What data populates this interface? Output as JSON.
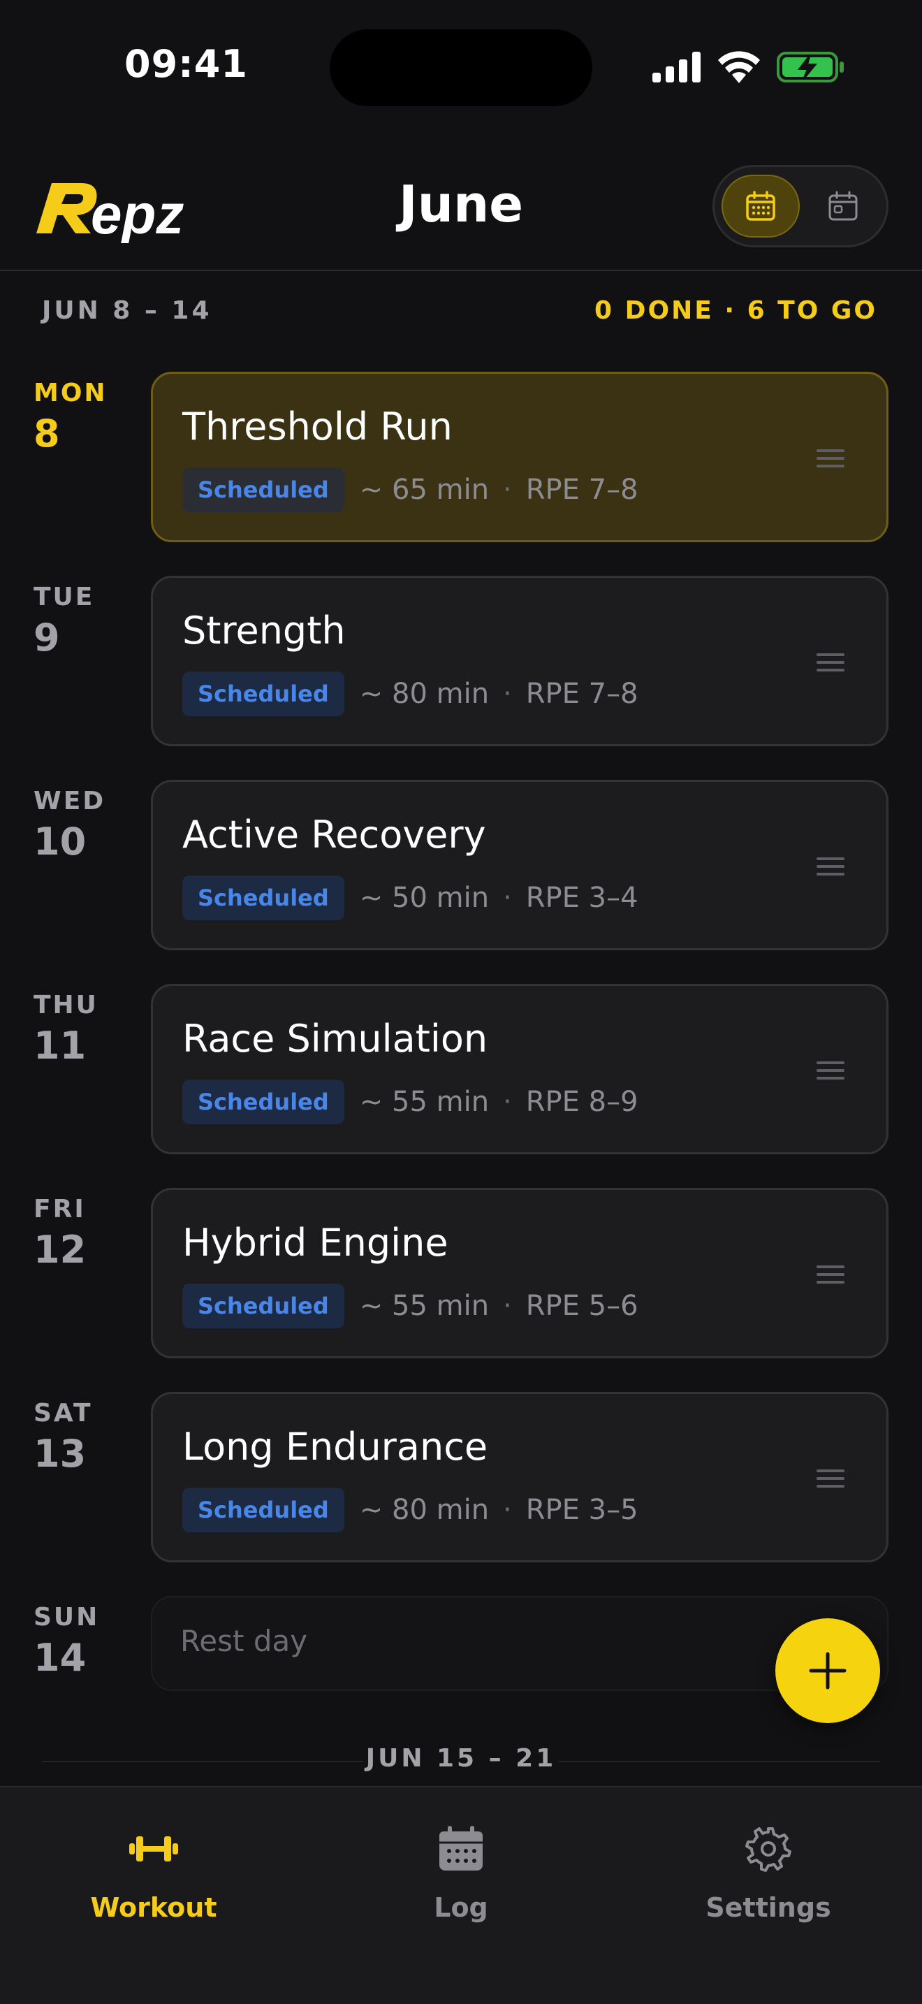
{
  "status_bar": {
    "time": "09:41"
  },
  "header": {
    "logo_text": "Repz",
    "title": "June",
    "view_toggle": [
      "calendar-week-icon",
      "calendar-day-icon"
    ]
  },
  "week": {
    "range": "JUN 8 – 14",
    "progress": "0 DONE · 6 TO GO"
  },
  "days": [
    {
      "day": "MON",
      "num": "8",
      "title": "Threshold Run",
      "status": "Scheduled",
      "duration": "~ 65 min",
      "rpe": "RPE 7–8",
      "today": true
    },
    {
      "day": "TUE",
      "num": "9",
      "title": "Strength",
      "status": "Scheduled",
      "duration": "~ 80 min",
      "rpe": "RPE 7–8"
    },
    {
      "day": "WED",
      "num": "10",
      "title": "Active Recovery",
      "status": "Scheduled",
      "duration": "~ 50 min",
      "rpe": "RPE 3–4"
    },
    {
      "day": "THU",
      "num": "11",
      "title": "Race Simulation",
      "status": "Scheduled",
      "duration": "~ 55 min",
      "rpe": "RPE 8–9"
    },
    {
      "day": "FRI",
      "num": "12",
      "title": "Hybrid Engine",
      "status": "Scheduled",
      "duration": "~ 55 min",
      "rpe": "RPE 5–6"
    },
    {
      "day": "SAT",
      "num": "13",
      "title": "Long Endurance",
      "status": "Scheduled",
      "duration": "~ 80 min",
      "rpe": "RPE 3–5"
    }
  ],
  "rest_day": {
    "day": "SUN",
    "num": "14",
    "label": "Rest day"
  },
  "next_week": {
    "range": "JUN 15 – 21"
  },
  "tabs": [
    {
      "label": "Workout",
      "icon": "dumbbell-icon",
      "active": true
    },
    {
      "label": "Log",
      "icon": "calendar-icon"
    },
    {
      "label": "Settings",
      "icon": "gear-icon"
    }
  ],
  "colors": {
    "accent": "#f5cc1a",
    "badge_text": "#4a86e8",
    "background": "#111113"
  }
}
